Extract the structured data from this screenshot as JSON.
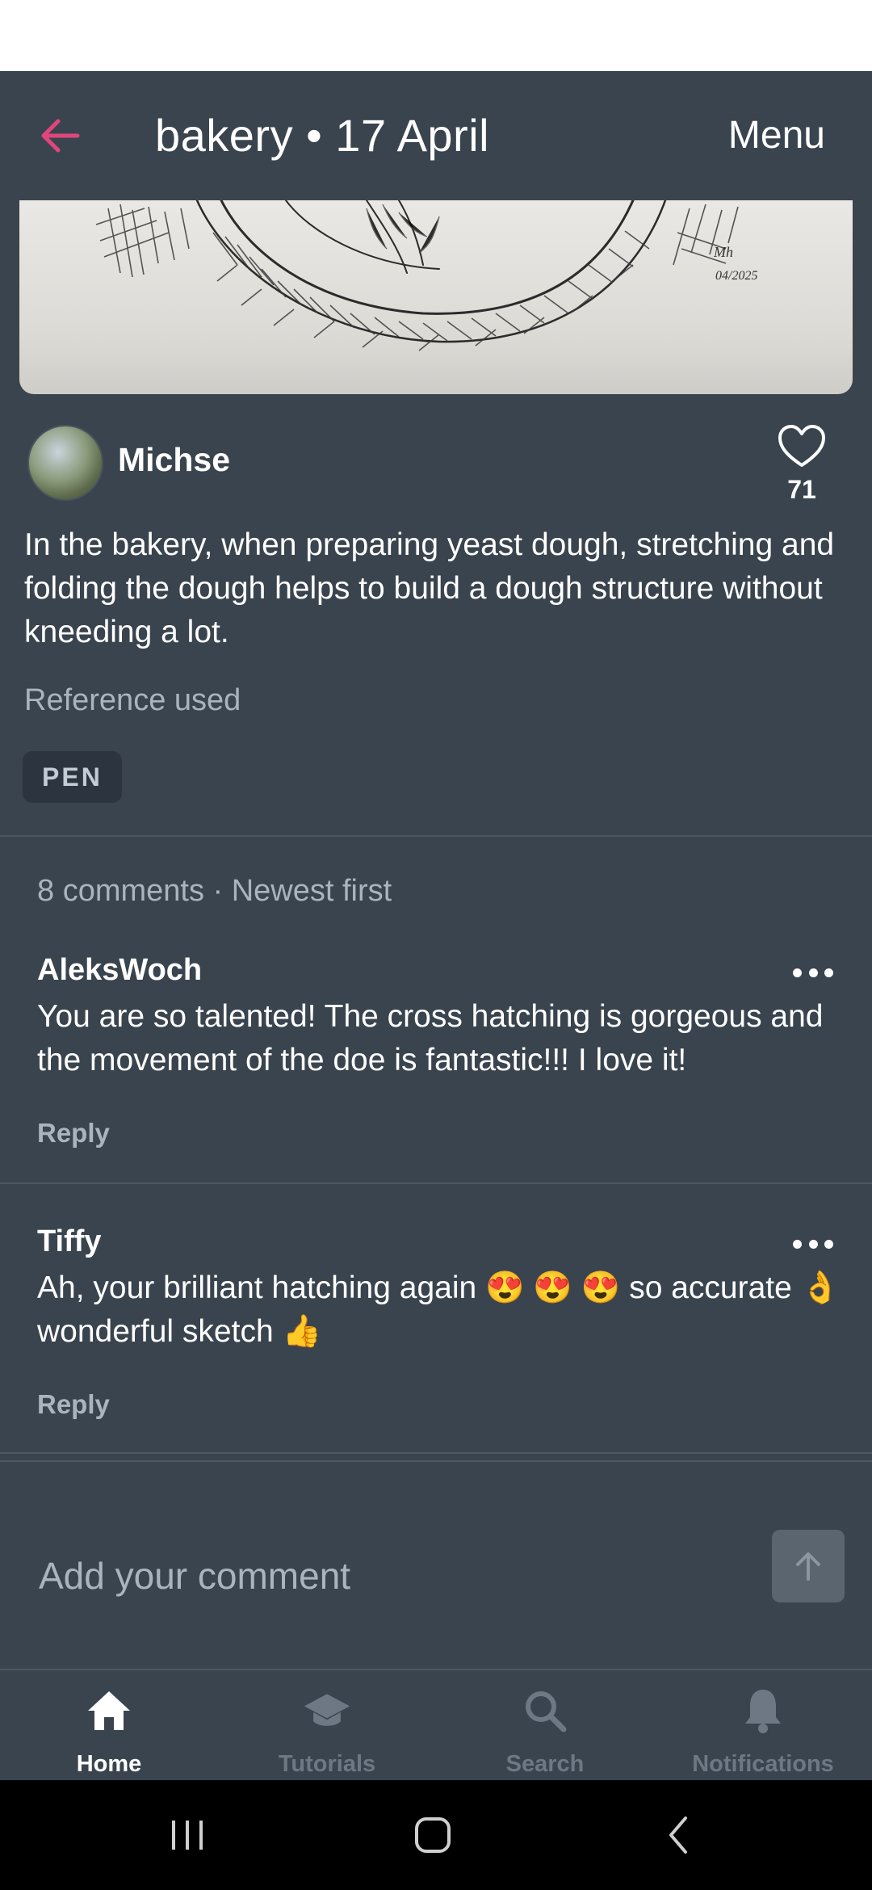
{
  "app_bar": {
    "title": "bakery • 17 April",
    "menu_label": "Menu",
    "accent": "#e0467c"
  },
  "post": {
    "author": "Michse",
    "likes": "71",
    "text": "In the bakery, when preparing yeast dough, stretching and folding the dough helps to build a dough structure without kneeding a lot.",
    "reference": "Reference used",
    "tag": "PEN",
    "artwork_signature": "Mh 04/2025"
  },
  "comments": {
    "header": "8 comments · Newest first",
    "items": [
      {
        "author": "AleksWoch",
        "body": "You are so talented! The cross hatching is gorgeous and the movement of the doe is fantastic!!! I love it!",
        "reply_label": "Reply"
      },
      {
        "author": "Tiffy",
        "body": "Ah, your brilliant hatching again 😍 😍 😍 so accurate  👌 wonderful sketch  👍",
        "reply_label": "Reply"
      }
    ]
  },
  "comment_input": {
    "placeholder": "Add your comment"
  },
  "bottom_nav": {
    "items": [
      {
        "label": "Home",
        "icon": "home-icon",
        "active": true
      },
      {
        "label": "Tutorials",
        "icon": "graduation-cap-icon",
        "active": false
      },
      {
        "label": "Search",
        "icon": "search-icon",
        "active": false
      },
      {
        "label": "Notifications",
        "icon": "bell-icon",
        "active": false
      }
    ]
  }
}
